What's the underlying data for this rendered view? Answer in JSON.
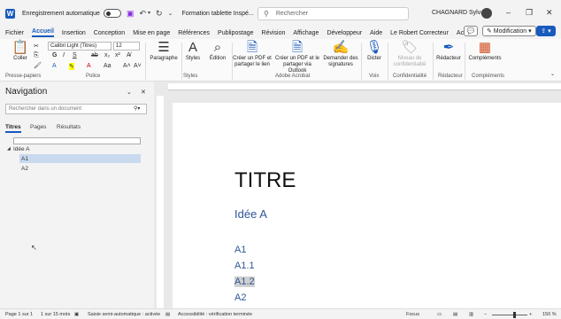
{
  "titlebar": {
    "app_icon": "W",
    "autosave_label": "Enregistrement automatique",
    "doc_title": "Formation tablette Inspé...",
    "search_placeholder": "Rechercher",
    "user_name": "CHAGNARD Sylvain"
  },
  "menu": [
    "Fichier",
    "Accueil",
    "Insertion",
    "Conception",
    "Mise en page",
    "Références",
    "Publipostage",
    "Révision",
    "Affichage",
    "Développeur",
    "Aide",
    "Le Robert Correcteur",
    "Acrobat"
  ],
  "menu_active": "Accueil",
  "buttons": {
    "modification": "✎ Modification ▾",
    "share": "⇪ ▾",
    "comment": "💬"
  },
  "ribbon": {
    "paste": "Coller",
    "font_name": "Calibri Light (Titres)",
    "font_size": "12",
    "paragraph": "Paragraphe",
    "styles": "Styles",
    "edition": "Édition",
    "create_pdf_link": "Créer un PDF et partager le lien",
    "create_pdf_outlook": "Créer un PDF et le partager via Outlook",
    "request_signatures": "Demander des signatures",
    "dictate": "Dicter",
    "confidentiality": "Niveau de confidentialité",
    "editor": "Rédacteur",
    "addins": "Compléments",
    "groups": {
      "clipboard": "Presse-papiers",
      "police": "Police",
      "styles": "Styles",
      "acrobat": "Adobe Acrobat",
      "voice": "Voix",
      "confidentialite": "Confidentialité",
      "redacteur": "Rédacteur",
      "complements": "Compléments"
    }
  },
  "navigation": {
    "title": "Navigation",
    "search_placeholder": "Rechercher dans un document",
    "tabs": [
      "Titres",
      "Pages",
      "Résultats"
    ],
    "tree": [
      {
        "label": "Idée A",
        "level": 0
      },
      {
        "label": "A1",
        "level": 1,
        "selected": true
      },
      {
        "label": "A2",
        "level": 1
      }
    ]
  },
  "document": {
    "title": "TITRE",
    "heading": "Idée A",
    "items": [
      "A1",
      "A1.1",
      "A1.2",
      "A2"
    ]
  },
  "status": {
    "page": "Page 1 sur 1",
    "words": "1 sur 15 mots",
    "lang": "Saisie semi-automatique : activée",
    "accessibility": "Accessibilité : vérification terminée",
    "focus": "Focus",
    "zoom": "150 %"
  },
  "colors": {
    "accent": "#185abd",
    "heading": "#2f5597"
  }
}
